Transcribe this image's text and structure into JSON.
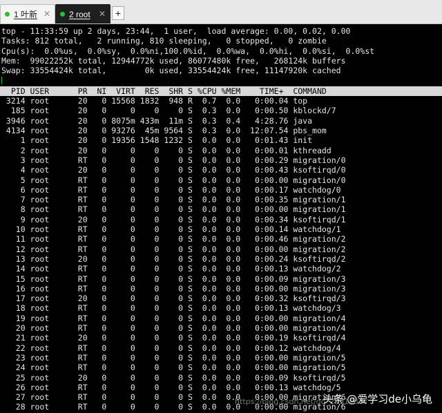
{
  "tabs": [
    {
      "label": "1 叶新",
      "active": false
    },
    {
      "label": "2 root",
      "active": true
    }
  ],
  "new_tab_label": "+",
  "summary_lines": [
    "top - 11:33:59 up 2 days, 23:44,  1 user,  load average: 0.00, 0.02, 0.00",
    "Tasks: 812 total,   2 running, 810 sleeping,   0 stopped,   0 zombie",
    "Cpu(s):  0.0%us,  0.0%sy,  0.0%ni,100.0%id,  0.0%wa,  0.0%hi,  0.0%si,  0.0%st",
    "Mem:  99022252k total, 12944772k used, 86077480k free,   268124k buffers",
    "Swap: 33554424k total,        0k used, 33554424k free, 11147920k cached"
  ],
  "process_header": "  PID USER      PR  NI  VIRT  RES  SHR S %CPU %MEM    TIME+  COMMAND",
  "process_rows": [
    " 3214 root      20   0 15568 1832  948 R  0.7  0.0   0:00.04 top",
    "  185 root      20   0     0    0    0 S  0.3  0.0   0:00.50 kblockd/7",
    " 3946 root      20   0 8075m 433m  11m S  0.3  0.4   4:28.76 java",
    " 4134 root      20   0 93276  45m 9564 S  0.3  0.0  12:07.54 pbs_mom",
    "    1 root      20   0 19356 1548 1232 S  0.0  0.0   0:01.43 init",
    "    2 root      20   0     0    0    0 S  0.0  0.0   0:00.01 kthreadd",
    "    3 root      RT   0     0    0    0 S  0.0  0.0   0:00.29 migration/0",
    "    4 root      20   0     0    0    0 S  0.0  0.0   0:00.43 ksoftirqd/0",
    "    5 root      RT   0     0    0    0 S  0.0  0.0   0:00.00 migration/0",
    "    6 root      RT   0     0    0    0 S  0.0  0.0   0:00.17 watchdog/0",
    "    7 root      RT   0     0    0    0 S  0.0  0.0   0:00.35 migration/1",
    "    8 root      RT   0     0    0    0 S  0.0  0.0   0:00.00 migration/1",
    "    9 root      20   0     0    0    0 S  0.0  0.0   0:00.34 ksoftirqd/1",
    "   10 root      RT   0     0    0    0 S  0.0  0.0   0:00.14 watchdog/1",
    "   11 root      RT   0     0    0    0 S  0.0  0.0   0:00.46 migration/2",
    "   12 root      RT   0     0    0    0 S  0.0  0.0   0:00.00 migration/2",
    "   13 root      20   0     0    0    0 S  0.0  0.0   0:00.24 ksoftirqd/2",
    "   14 root      RT   0     0    0    0 S  0.0  0.0   0:00.13 watchdog/2",
    "   15 root      RT   0     0    0    0 S  0.0  0.0   0:00.09 migration/3",
    "   16 root      RT   0     0    0    0 S  0.0  0.0   0:00.00 migration/3",
    "   17 root      20   0     0    0    0 S  0.0  0.0   0:00.32 ksoftirqd/3",
    "   18 root      RT   0     0    0    0 S  0.0  0.0   0:00.13 watchdog/3",
    "   19 root      RT   0     0    0    0 S  0.0  0.0   0:00.00 migration/4",
    "   20 root      RT   0     0    0    0 S  0.0  0.0   0:00.00 migration/4",
    "   21 root      20   0     0    0    0 S  0.0  0.0   0:00.19 ksoftirqd/4",
    "   22 root      RT   0     0    0    0 S  0.0  0.0   0:00.12 watchdog/4",
    "   23 root      RT   0     0    0    0 S  0.0  0.0   0:00.00 migration/5",
    "   24 root      RT   0     0    0    0 S  0.0  0.0   0:00.00 migration/5",
    "   25 root      20   0     0    0    0 S  0.0  0.0   0:00.09 ksoftirqd/5",
    "   26 root      RT   0     0    0    0 S  0.0  0.0   0:00.13 watchdog/5",
    "   27 root      RT   0     0    0    0 S  0.0  0.0   0:00.00 migration/6",
    "   28 root      RT   0     0    0    0 S  0.0  0.0   0:00.00 migration/6"
  ],
  "watermark_text": "头条 @爱学习de小乌龟",
  "url_blurb": "https://blog.csdn.net/qq_29914837",
  "colors": {
    "terminal_bg": "#000000",
    "terminal_fg": "#e6e6e6",
    "header_bg": "#d8d8d8",
    "tab_indicator": "#2cbf2c"
  }
}
